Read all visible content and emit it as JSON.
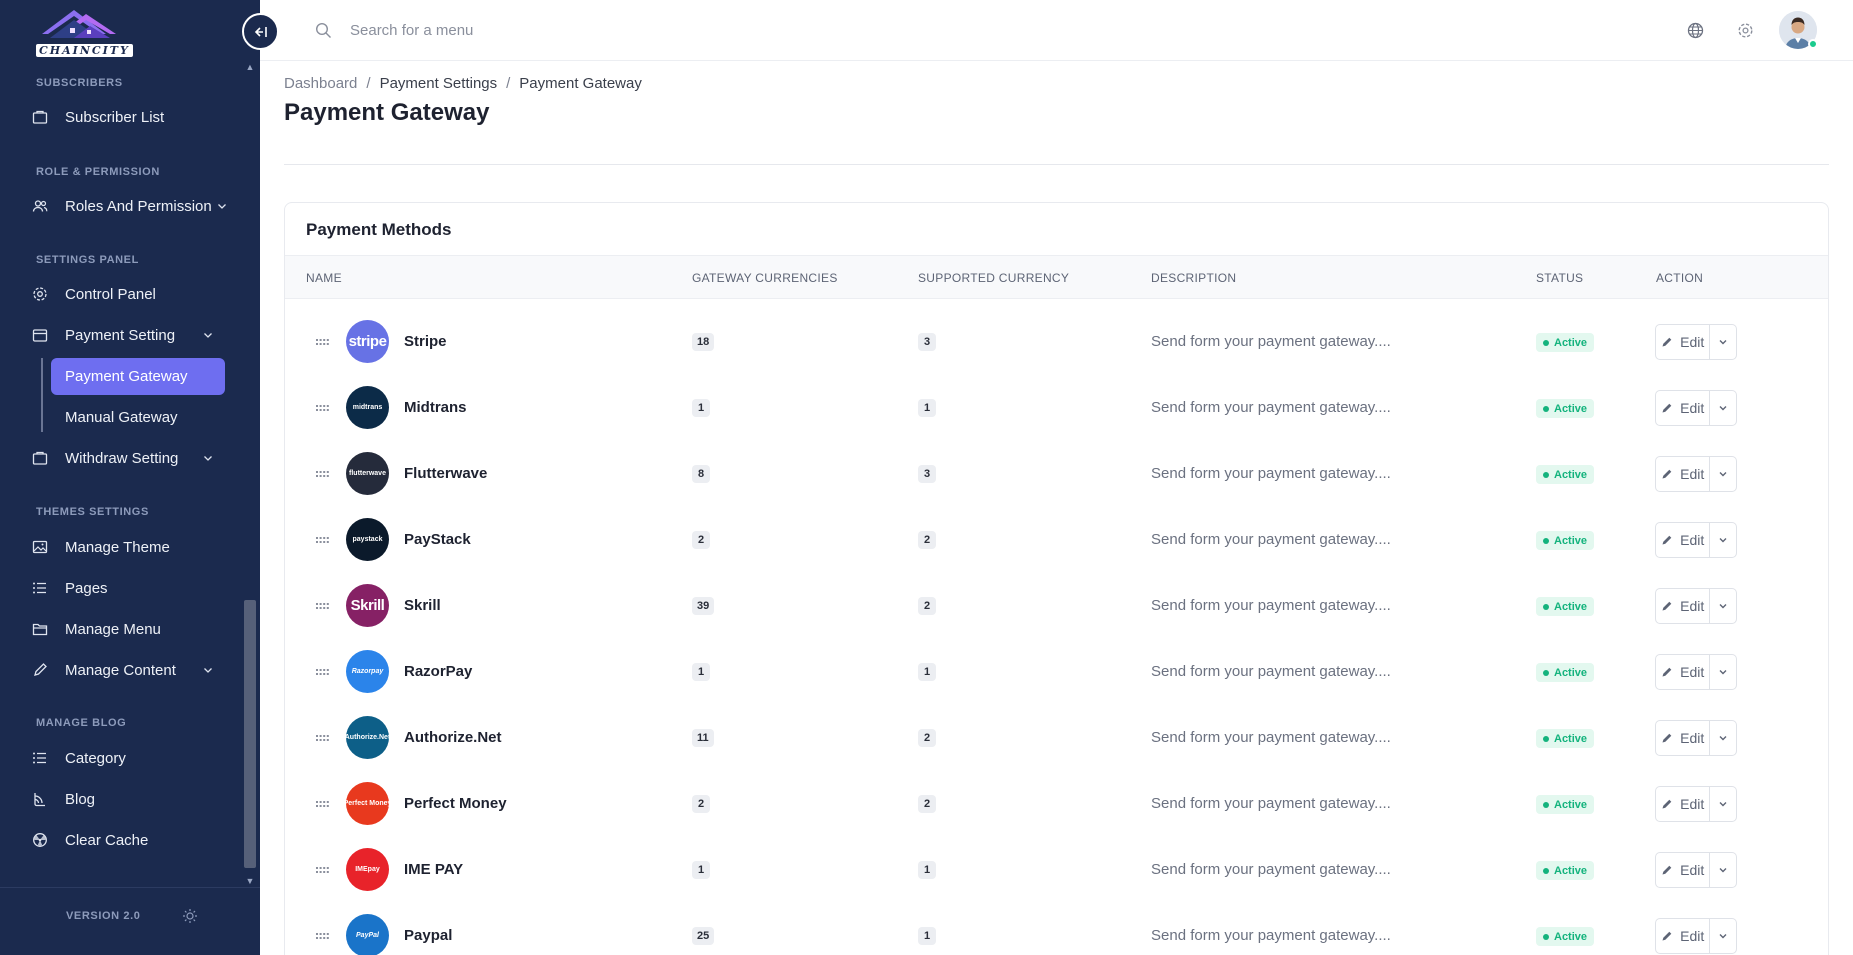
{
  "app": {
    "logo_text": "CHAINCITY",
    "version": "VERSION 2.0"
  },
  "topbar": {
    "search_placeholder": "Search for a menu"
  },
  "sidebar": {
    "sections": [
      {
        "title": "SUBSCRIBERS"
      },
      {
        "title": "ROLE & PERMISSION"
      },
      {
        "title": "SETTINGS PANEL"
      },
      {
        "title": "THEMES SETTINGS"
      },
      {
        "title": "MANAGE BLOG"
      }
    ],
    "items": {
      "subscriber_list": "Subscriber List",
      "roles": "Roles And Permission",
      "control_panel": "Control Panel",
      "payment_setting": "Payment Setting",
      "payment_gateway": "Payment Gateway",
      "manual_gateway": "Manual Gateway",
      "withdraw_setting": "Withdraw Setting",
      "manage_theme": "Manage Theme",
      "pages": "Pages",
      "manage_menu": "Manage Menu",
      "manage_content": "Manage Content",
      "category": "Category",
      "blog": "Blog",
      "clear_cache": "Clear Cache"
    }
  },
  "breadcrumb": [
    "Dashboard",
    "/",
    "Payment Settings",
    "/",
    "Payment Gateway"
  ],
  "page_title": "Payment Gateway",
  "card": {
    "title": "Payment Methods",
    "columns": [
      "NAME",
      "GATEWAY CURRENCIES",
      "SUPPORTED CURRENCY",
      "DESCRIPTION",
      "STATUS",
      "ACTION"
    ],
    "edit_label": "Edit",
    "rows": [
      {
        "name": "Stripe",
        "logo": "stripe",
        "logo_text": "stripe",
        "logo_color": "#6772e5",
        "gateway_currencies": "18",
        "supported_currency": "3",
        "description": "Send form your payment gateway....",
        "status": "Active"
      },
      {
        "name": "Midtrans",
        "logo": "midtrans",
        "logo_text": "midtrans",
        "logo_color": "#0c2b48",
        "gateway_currencies": "1",
        "supported_currency": "1",
        "description": "Send form your payment gateway....",
        "status": "Active"
      },
      {
        "name": "Flutterwave",
        "logo": "flutterwave",
        "logo_text": "flutterwave",
        "logo_color": "#252b3b",
        "gateway_currencies": "8",
        "supported_currency": "3",
        "description": "Send form your payment gateway....",
        "status": "Active"
      },
      {
        "name": "PayStack",
        "logo": "paystack",
        "logo_text": "paystack",
        "logo_color": "#0b1a2b",
        "gateway_currencies": "2",
        "supported_currency": "2",
        "description": "Send form your payment gateway....",
        "status": "Active"
      },
      {
        "name": "Skrill",
        "logo": "skrill",
        "logo_text": "Skrill",
        "logo_color": "#862165",
        "gateway_currencies": "39",
        "supported_currency": "2",
        "description": "Send form your payment gateway....",
        "status": "Active"
      },
      {
        "name": "RazorPay",
        "logo": "razorpay",
        "logo_text": "Razorpay",
        "logo_color": "#2b84ea",
        "gateway_currencies": "1",
        "supported_currency": "1",
        "description": "Send form your payment gateway....",
        "status": "Active"
      },
      {
        "name": "Authorize.Net",
        "logo": "authorize-net",
        "logo_text": "Authorize.Net",
        "logo_color": "#0d5f88",
        "gateway_currencies": "11",
        "supported_currency": "2",
        "description": "Send form your payment gateway....",
        "status": "Active"
      },
      {
        "name": "Perfect Money",
        "logo": "perfect-money",
        "logo_text": "Perfect Money",
        "logo_color": "#e8391e",
        "gateway_currencies": "2",
        "supported_currency": "2",
        "description": "Send form your payment gateway....",
        "status": "Active"
      },
      {
        "name": "IME PAY",
        "logo": "ime-pay",
        "logo_text": "IMEpay",
        "logo_color": "#e8232a",
        "gateway_currencies": "1",
        "supported_currency": "1",
        "description": "Send form your payment gateway....",
        "status": "Active"
      },
      {
        "name": "Paypal",
        "logo": "paypal",
        "logo_text": "PayPal",
        "logo_color": "#1a74c9",
        "gateway_currencies": "25",
        "supported_currency": "1",
        "description": "Send form your payment gateway....",
        "status": "Active"
      }
    ]
  },
  "colors": {
    "sidebar_bg": "#1b2a4e",
    "accent": "#6e6ef0",
    "status_green": "#14b37d"
  },
  "icons": [
    "search-icon",
    "globe-icon",
    "gear-icon",
    "collapse-icon",
    "sun-icon",
    "edit-icon",
    "chevron-down-icon",
    "drag-handle-icon"
  ]
}
